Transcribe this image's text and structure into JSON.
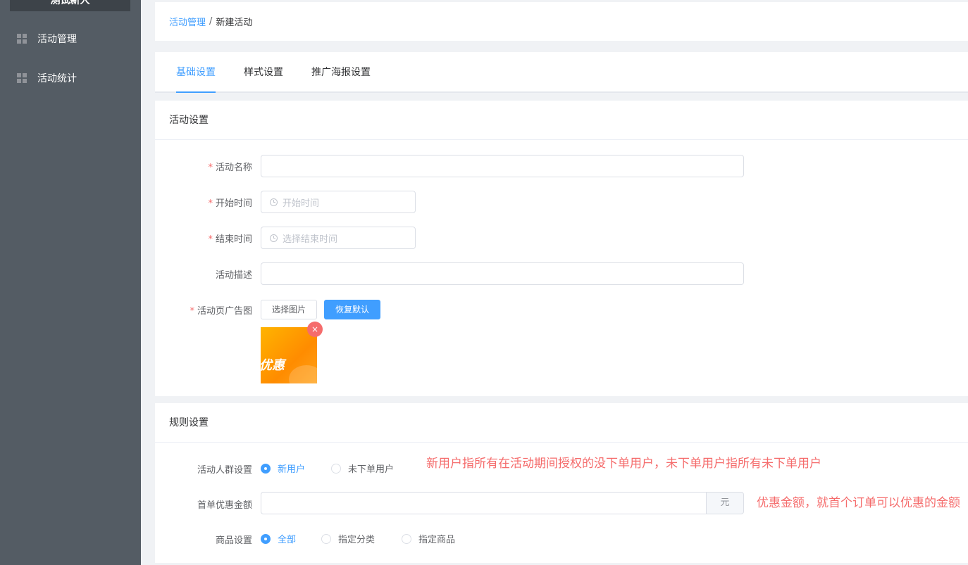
{
  "sidebar": {
    "brand": "测试新人",
    "items": [
      {
        "label": "活动管理"
      },
      {
        "label": "活动统计"
      }
    ]
  },
  "breadcrumb": {
    "parent": "活动管理",
    "separator": "/",
    "current": "新建活动"
  },
  "tabs": [
    {
      "label": "基础设置",
      "active": true
    },
    {
      "label": "样式设置",
      "active": false
    },
    {
      "label": "推广海报设置",
      "active": false
    }
  ],
  "activity_settings": {
    "title": "活动设置",
    "name": {
      "label": "活动名称",
      "value": ""
    },
    "start_time": {
      "label": "开始时间",
      "placeholder": "开始时间"
    },
    "end_time": {
      "label": "结束时间",
      "placeholder": "选择结束时间"
    },
    "description": {
      "label": "活动描述",
      "value": ""
    },
    "ad_image": {
      "label": "活动页广告图",
      "select_button": "选择图片",
      "restore_button": "恢复默认",
      "thumbnail_text": "优惠",
      "remove_icon": "×"
    }
  },
  "rule_settings": {
    "title": "规则设置",
    "audience": {
      "label": "活动人群设置",
      "options": [
        {
          "label": "新用户",
          "checked": true
        },
        {
          "label": "未下单用户",
          "checked": false
        }
      ],
      "note": "新用户指所有在活动期间授权的没下单用户，未下单用户指所有未下单用户"
    },
    "first_order_discount": {
      "label": "首单优惠金额",
      "value": "",
      "suffix": "元",
      "note": "优惠金额，就首个订单可以优惠的金额"
    },
    "products": {
      "label": "商品设置",
      "options": [
        {
          "label": "全部",
          "checked": true
        },
        {
          "label": "指定分类",
          "checked": false
        },
        {
          "label": "指定商品",
          "checked": false
        }
      ]
    }
  },
  "colors": {
    "primary": "#409eff",
    "danger": "#f56c6c",
    "sidebar_bg": "#545c64"
  }
}
